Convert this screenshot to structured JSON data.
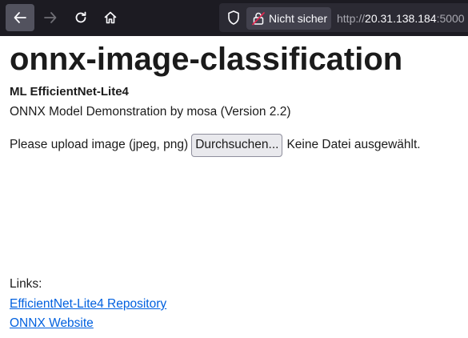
{
  "browser": {
    "security_label": "Nicht sicher",
    "url_scheme": "http://",
    "url_host": "20.31.138.184",
    "url_port": ":5000",
    "icons": [
      "back-icon",
      "forward-icon",
      "reload-icon",
      "home-icon",
      "shield-icon",
      "insecure-lock-icon"
    ]
  },
  "page": {
    "title": "onnx-image-classification",
    "subtitle": "ML EfficientNet-Lite4",
    "description": "ONNX Model Demonstration by mosa (Version 2.2)",
    "upload": {
      "prompt": "Please upload image (jpeg, png)",
      "button_label": "Durchsuchen...",
      "status": "Keine Datei ausgewählt."
    },
    "links": {
      "heading": "Links:",
      "items": [
        {
          "label": "EfficientNet-Lite4 Repository"
        },
        {
          "label": "ONNX Website"
        }
      ]
    }
  },
  "colors": {
    "toolbar_bg": "#1c1b22",
    "link": "#0060df",
    "text": "#1b1b1b"
  }
}
